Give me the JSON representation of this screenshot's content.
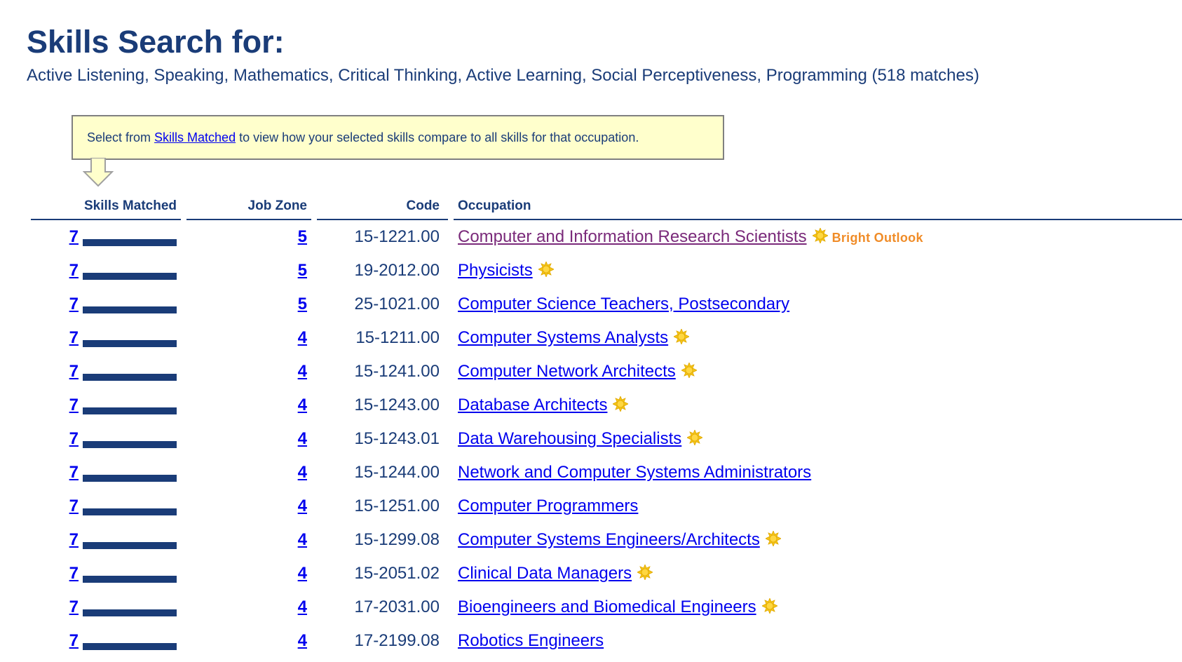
{
  "page": {
    "title": "Skills Search for:",
    "skills_line": "Active Listening, Speaking, Mathematics, Critical Thinking, Active Learning, Social Perceptiveness, Programming (518 matches)"
  },
  "callout": {
    "prefix": "Select from ",
    "link_text": "Skills Matched",
    "suffix": " to view how your selected skills compare to all skills for that occupation."
  },
  "table": {
    "headers": {
      "skills_matched": "Skills Matched",
      "job_zone": "Job Zone",
      "code": "Code",
      "occupation": "Occupation"
    },
    "bright_outlook_label": "Bright Outlook",
    "rows": [
      {
        "skills": "7",
        "skills_bar_fraction": 1.0,
        "zone": "5",
        "code": "15-1221.00",
        "occupation": "Computer and Information Research Scientists",
        "bright": true,
        "visited": true,
        "show_label": true
      },
      {
        "skills": "7",
        "skills_bar_fraction": 1.0,
        "zone": "5",
        "code": "19-2012.00",
        "occupation": "Physicists",
        "bright": true,
        "visited": false,
        "show_label": false
      },
      {
        "skills": "7",
        "skills_bar_fraction": 1.0,
        "zone": "5",
        "code": "25-1021.00",
        "occupation": "Computer Science Teachers, Postsecondary",
        "bright": false,
        "visited": false,
        "show_label": false
      },
      {
        "skills": "7",
        "skills_bar_fraction": 1.0,
        "zone": "4",
        "code": "15-1211.00",
        "occupation": "Computer Systems Analysts",
        "bright": true,
        "visited": false,
        "show_label": false
      },
      {
        "skills": "7",
        "skills_bar_fraction": 1.0,
        "zone": "4",
        "code": "15-1241.00",
        "occupation": "Computer Network Architects",
        "bright": true,
        "visited": false,
        "show_label": false
      },
      {
        "skills": "7",
        "skills_bar_fraction": 1.0,
        "zone": "4",
        "code": "15-1243.00",
        "occupation": "Database Architects",
        "bright": true,
        "visited": false,
        "show_label": false
      },
      {
        "skills": "7",
        "skills_bar_fraction": 1.0,
        "zone": "4",
        "code": "15-1243.01",
        "occupation": "Data Warehousing Specialists",
        "bright": true,
        "visited": false,
        "show_label": false
      },
      {
        "skills": "7",
        "skills_bar_fraction": 1.0,
        "zone": "4",
        "code": "15-1244.00",
        "occupation": "Network and Computer Systems Administrators",
        "bright": false,
        "visited": false,
        "show_label": false
      },
      {
        "skills": "7",
        "skills_bar_fraction": 1.0,
        "zone": "4",
        "code": "15-1251.00",
        "occupation": "Computer Programmers",
        "bright": false,
        "visited": false,
        "show_label": false
      },
      {
        "skills": "7",
        "skills_bar_fraction": 1.0,
        "zone": "4",
        "code": "15-1299.08",
        "occupation": "Computer Systems Engineers/Architects",
        "bright": true,
        "visited": false,
        "show_label": false
      },
      {
        "skills": "7",
        "skills_bar_fraction": 1.0,
        "zone": "4",
        "code": "15-2051.02",
        "occupation": "Clinical Data Managers",
        "bright": true,
        "visited": false,
        "show_label": false
      },
      {
        "skills": "7",
        "skills_bar_fraction": 1.0,
        "zone": "4",
        "code": "17-2031.00",
        "occupation": "Bioengineers and Biomedical Engineers",
        "bright": true,
        "visited": false,
        "show_label": false
      },
      {
        "skills": "7",
        "skills_bar_fraction": 1.0,
        "zone": "4",
        "code": "17-2199.08",
        "occupation": "Robotics Engineers",
        "bright": false,
        "visited": false,
        "show_label": false
      }
    ]
  },
  "icons": {
    "bright_outlook": "sun-icon",
    "callout_pointer": "down-arrow-icon"
  },
  "colors": {
    "heading": "#1a3c78",
    "link": "#0000ee",
    "visited_link": "#7a2a7a",
    "callout_bg": "#ffffcc",
    "bright_outlook": "#f08c28",
    "sun_fill": "#f5c518"
  }
}
